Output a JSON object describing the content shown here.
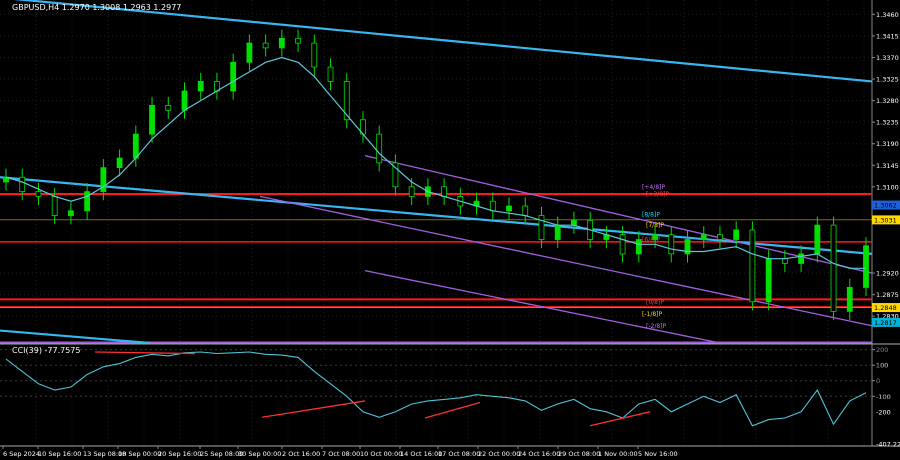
{
  "header": {
    "symbol_line": "GBPUSD,H4  1.2970 1.3008 1.2963 1.2977",
    "indicator_line": "CCI(39) -77.7575"
  },
  "chart_data": {
    "type": "candlestick",
    "title": "GBPUSD,H4",
    "ohlc": {
      "open": 1.297,
      "high": 1.3008,
      "low": 1.2963,
      "close": 1.2977
    },
    "ylim": [
      1.2774,
      1.349
    ],
    "yticks": [
      "1.3460",
      "1.3415",
      "1.3370",
      "1.3325",
      "1.3280",
      "1.3235",
      "1.3190",
      "1.3145",
      "1.3100",
      "1.2920",
      "1.2875",
      "1.2830"
    ],
    "price_tags": [
      {
        "text": "1.3062",
        "value": 1.3062,
        "bg": "#1e60d8"
      },
      {
        "text": "1.3031",
        "value": 1.3031,
        "bg": "#ffd800"
      },
      {
        "text": "1.2848",
        "value": 1.2848,
        "bg": "#ffd800"
      },
      {
        "text": "1.2817",
        "value": 1.2817,
        "bg": "#00b4d8"
      }
    ],
    "x_labels": [
      "6 Sep 2024",
      "10 Sep 16:00",
      "13 Sep 08:00",
      "18 Sep 00:00",
      "20 Sep 16:00",
      "25 Sep 08:00",
      "30 Sep 00:00",
      "2 Oct 16:00",
      "7 Oct 08:00",
      "10 Oct 00:00",
      "14 Oct 16:00",
      "17 Oct 08:00",
      "22 Oct 00:00",
      "24 Oct 16:00",
      "29 Oct 08:00",
      "1 Nov 00:00",
      "5 Nov 16:00"
    ],
    "series": [
      {
        "kind": "price",
        "style": "candles",
        "color": "#00e000",
        "values": [
          1.312,
          1.309,
          1.308,
          1.304,
          1.305,
          1.309,
          1.314,
          1.316,
          1.321,
          1.327,
          1.326,
          1.33,
          1.332,
          1.33,
          1.336,
          1.34,
          1.339,
          1.341,
          1.34,
          1.335,
          1.332,
          1.324,
          1.321,
          1.315,
          1.31,
          1.308,
          1.31,
          1.308,
          1.306,
          1.307,
          1.305,
          1.306,
          1.304,
          1.299,
          1.302,
          1.303,
          1.299,
          1.3,
          1.296,
          1.299,
          1.3,
          1.296,
          1.299,
          1.3,
          1.299,
          1.301,
          1.286,
          1.295,
          1.294,
          1.296,
          1.302,
          1.284,
          1.289,
          1.2977
        ]
      },
      {
        "kind": "price",
        "style": "moving-average",
        "color": "#5ec8d8",
        "values": [
          1.312,
          1.311,
          1.3095,
          1.308,
          1.307,
          1.308,
          1.31,
          1.3125,
          1.316,
          1.32,
          1.323,
          1.326,
          1.328,
          1.33,
          1.332,
          1.334,
          1.336,
          1.337,
          1.336,
          1.333,
          1.329,
          1.325,
          1.321,
          1.317,
          1.314,
          1.311,
          1.309,
          1.308,
          1.307,
          1.306,
          1.305,
          1.3045,
          1.304,
          1.303,
          1.302,
          1.302,
          1.301,
          1.3,
          1.299,
          1.298,
          1.298,
          1.297,
          1.2965,
          1.2965,
          1.297,
          1.2975,
          1.296,
          1.295,
          1.295,
          1.2955,
          1.296,
          1.294,
          1.293,
          1.293
        ]
      },
      {
        "kind": "cci",
        "name": "CCI(39)",
        "color": "#4fc3d6",
        "values": [
          140,
          60,
          -20,
          -60,
          -40,
          40,
          90,
          110,
          150,
          170,
          160,
          180,
          185,
          175,
          180,
          185,
          170,
          165,
          150,
          60,
          -20,
          -100,
          -200,
          -235,
          -200,
          -150,
          -130,
          -120,
          -110,
          -90,
          -100,
          -110,
          -130,
          -190,
          -150,
          -120,
          -180,
          -200,
          -240,
          -150,
          -120,
          -200,
          -150,
          -100,
          -140,
          -90,
          -290,
          -250,
          -240,
          -200,
          -60,
          -280,
          -130,
          -77.7575
        ]
      }
    ],
    "cci_yticks": [
      "100",
      "-100",
      "-200",
      "-407.229"
    ],
    "cci_level_tags": [
      "200",
      "100",
      "0",
      "-100"
    ],
    "channel_labels": [
      {
        "text": "[+4/8]P",
        "value": 1.31,
        "color": "#cc66ff"
      },
      {
        "text": "[+3/8]P",
        "value": 1.3085,
        "color": "#ff4444"
      },
      {
        "text": "[8/8]P",
        "value": 1.3042,
        "color": "#00e0ff"
      },
      {
        "text": "[7/8]P",
        "value": 1.302,
        "color": "#ffd800"
      },
      {
        "text": "[6/8]P",
        "value": 1.299,
        "color": "#ff4444"
      },
      {
        "text": "[0/8]P",
        "value": 1.286,
        "color": "#ff4444"
      },
      {
        "text": "[-1/8]P",
        "value": 1.2835,
        "color": "#ffd800"
      },
      {
        "text": "[-2/8]P",
        "value": 1.281,
        "color": "#cc66ff"
      }
    ],
    "colors": {
      "background": "#000000",
      "candle": "#00e000",
      "moving_average": "#5ec8d8",
      "trendline": "#37b6ef",
      "channel": "#a25fe0",
      "resistance": "#ff1a1a",
      "divergence": "#ff3030",
      "grid": "#1c1c1c",
      "separator": "#aaaaaa"
    }
  }
}
